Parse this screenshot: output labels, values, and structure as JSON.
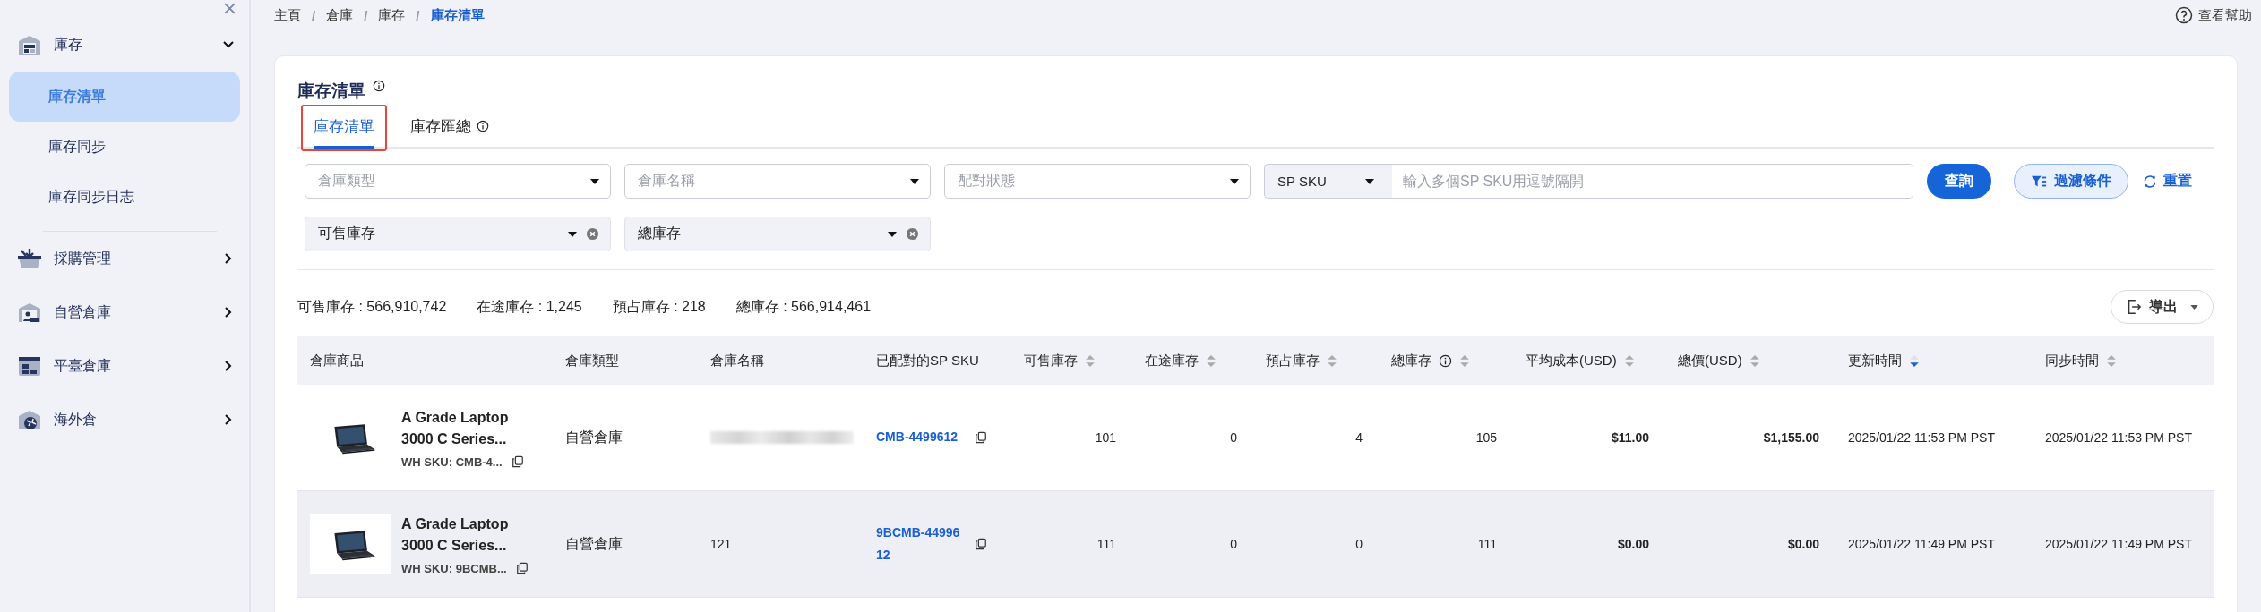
{
  "sidebar": {
    "items": [
      {
        "label": "庫存",
        "expanded": true,
        "children": [
          {
            "label": "庫存清單",
            "selected": true
          },
          {
            "label": "庫存同步",
            "selected": false
          },
          {
            "label": "庫存同步日志",
            "selected": false
          }
        ]
      },
      {
        "label": "採購管理",
        "expanded": false
      },
      {
        "label": "自營倉庫",
        "expanded": false
      },
      {
        "label": "平臺倉庫",
        "expanded": false
      },
      {
        "label": "海外倉",
        "expanded": false
      }
    ]
  },
  "breadcrumb": [
    {
      "label": "主頁",
      "current": false
    },
    {
      "separator": "/",
      "label": "倉庫",
      "current": false
    },
    {
      "separator": "/",
      "label": "庫存",
      "current": false
    },
    {
      "separator": "/",
      "label": "庫存清單",
      "current": true
    }
  ],
  "help_link": "查看幫助",
  "page_title": "庫存清單",
  "tabs": [
    {
      "label": "庫存清單",
      "selected": true,
      "info": false,
      "annotated": true
    },
    {
      "label": "庫存匯總",
      "selected": false,
      "info": true,
      "annotated": false
    }
  ],
  "filters": [
    {
      "kind": "select",
      "placeholder": "倉庫類型"
    },
    {
      "kind": "select",
      "placeholder": "倉庫名稱"
    },
    {
      "kind": "select",
      "placeholder": "配對狀態"
    },
    {
      "kind": "sku_search",
      "select_value": "SP SKU",
      "placeholder": "輸入多個SP SKU用逗號隔開"
    }
  ],
  "search_button": "查詢",
  "filter_button": "過濾條件",
  "reset_button": "重置",
  "extra_filters": [
    {
      "kind": "select",
      "value": "可售庫存"
    },
    {
      "kind": "select",
      "value": "總庫存"
    }
  ],
  "summary": [
    "可售庫存 : 566,910,742",
    "在途庫存 : 1,245",
    "預占庫存 : 218",
    "總庫存 : 566,914,461"
  ],
  "export_button": "導出",
  "table": {
    "columns": [
      {
        "label": "倉庫商品",
        "sortable": false,
        "info": false
      },
      {
        "label": "倉庫類型",
        "sortable": false,
        "info": false
      },
      {
        "label": "倉庫名稱",
        "sortable": false,
        "info": false
      },
      {
        "label": "已配對的SP SKU",
        "sortable": false,
        "info": false
      },
      {
        "label": "可售庫存",
        "sortable": true,
        "sorted_desc": false,
        "info": false
      },
      {
        "label": "在途庫存",
        "sortable": true,
        "sorted_desc": false,
        "info": false
      },
      {
        "label": "預占庫存",
        "sortable": true,
        "sorted_desc": false,
        "info": false
      },
      {
        "label": "總庫存",
        "sortable": true,
        "sorted_desc": false,
        "info": true
      },
      {
        "label": "平均成本(USD)",
        "sortable": true,
        "sorted_desc": false,
        "info": false
      },
      {
        "label": "總價(USD)",
        "sortable": true,
        "sorted_desc": false,
        "info": false
      },
      {
        "label": "更新時間",
        "sortable": true,
        "sorted_desc": true,
        "info": false
      },
      {
        "label": "同步時間",
        "sortable": true,
        "sorted_desc": false,
        "info": false
      }
    ],
    "rows": [
      {
        "hovered": false,
        "product": {
          "kind": "picture",
          "name": "A Grade Laptop 3000 C Series...",
          "wh_sku": "WH SKU: CMB-4..."
        },
        "type": "自營倉庫",
        "warehouse_name": {
          "redacted": true
        },
        "sp_sku": "CMB-4499612",
        "available": "101",
        "in_transit": "0",
        "reserved": "4",
        "total": "105",
        "avg_cost": "$11.00",
        "total_price": "$1,155.00",
        "updated": "2025/01/22 11:53 PM PST",
        "synced": "2025/01/22 11:53 PM PST"
      },
      {
        "hovered": true,
        "product": {
          "kind": "picture",
          "name": "A Grade Laptop 3000 C Series...",
          "wh_sku": "WH SKU: 9BCMB..."
        },
        "type": "自營倉庫",
        "warehouse_name": {
          "redacted": false,
          "text": "121"
        },
        "sp_sku": "9BCMB-4499612",
        "available": "111",
        "in_transit": "0",
        "reserved": "0",
        "total": "111",
        "avg_cost": "$0.00",
        "total_price": "$0.00",
        "updated": "2025/01/22 11:49 PM PST",
        "synced": "2025/01/22 11:49 PM PST"
      }
    ]
  }
}
